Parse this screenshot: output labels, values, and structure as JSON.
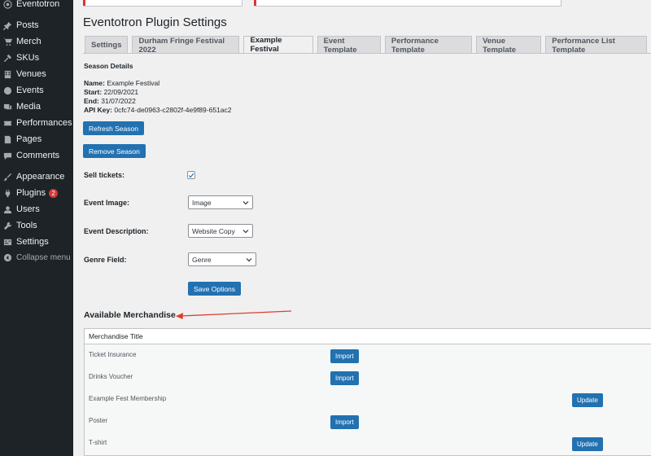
{
  "sidebar": {
    "brand": "Eventotron",
    "items": [
      {
        "label": "Posts",
        "icon": "pin-icon"
      },
      {
        "label": "Merch",
        "icon": "cart-icon"
      },
      {
        "label": "SKUs",
        "icon": "tools-icon"
      },
      {
        "label": "Venues",
        "icon": "building-icon"
      },
      {
        "label": "Events",
        "icon": "globe-icon"
      },
      {
        "label": "Media",
        "icon": "media-icon"
      },
      {
        "label": "Performances",
        "icon": "ticket-icon"
      },
      {
        "label": "Pages",
        "icon": "page-icon"
      },
      {
        "label": "Comments",
        "icon": "comment-icon"
      },
      {
        "label": "Appearance",
        "icon": "brush-icon"
      },
      {
        "label": "Plugins",
        "icon": "plug-icon",
        "badge": "2"
      },
      {
        "label": "Users",
        "icon": "user-icon"
      },
      {
        "label": "Tools",
        "icon": "wrench-icon"
      },
      {
        "label": "Settings",
        "icon": "settings-icon"
      },
      {
        "label": "Collapse menu",
        "icon": "collapse-icon"
      }
    ]
  },
  "page": {
    "title": "Eventotron Plugin Settings",
    "tabs": [
      "Settings",
      "Durham Fringe Festival 2022",
      "Example Festival",
      "Event Template",
      "Performance Template",
      "Venue Template",
      "Performance List Template"
    ],
    "active_tab": "Example Festival"
  },
  "season": {
    "heading": "Season Details",
    "name_label": "Name:",
    "name": "Example Festival",
    "start_label": "Start:",
    "start": "22/09/2021",
    "end_label": "End:",
    "end": "31/07/2022",
    "api_label": "API Key:",
    "api_key": "0cfc74-de0963-c2802f-4e9f89-651ac2",
    "refresh_button": "Refresh Season",
    "remove_button": "Remove Season"
  },
  "form": {
    "sell_tickets_label": "Sell tickets:",
    "sell_tickets_checked": true,
    "event_image_label": "Event Image:",
    "event_image_value": "Image",
    "event_description_label": "Event Description:",
    "event_description_value": "Website Copy",
    "genre_label": "Genre Field:",
    "genre_value": "Genre",
    "save_button": "Save Options"
  },
  "merch": {
    "heading": "Available Merchandise",
    "column_title": "Merchandise Title",
    "rows": [
      {
        "title": "Ticket Insurance",
        "action": "Import"
      },
      {
        "title": "Drinks Voucher",
        "action": "Import"
      },
      {
        "title": "Example Fest Membership",
        "action": "Update"
      },
      {
        "title": "Poster",
        "action": "Import"
      },
      {
        "title": "T-shirt",
        "action": "Update"
      }
    ]
  },
  "colors": {
    "sidebar_bg": "#1d2327",
    "primary_button": "#2271b1",
    "badge": "#d63638",
    "annotation_arrow": "#e03c31"
  }
}
